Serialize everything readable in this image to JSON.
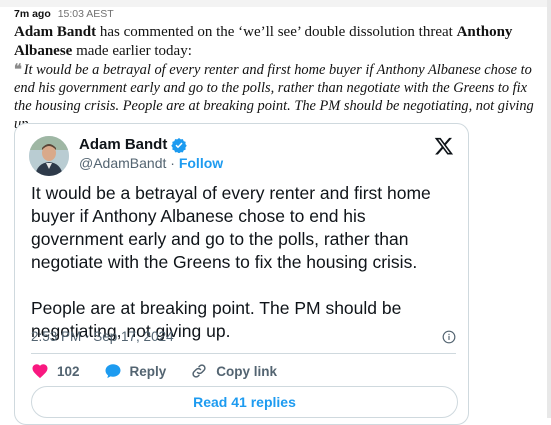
{
  "post": {
    "time_ago": "7m ago",
    "time": "15:03 AEST",
    "lead_name": "Adam Bandt",
    "lead_text": " has commented on the ‘we’ll see’ double dissolution threat ",
    "lead_name2": "Anthony Albanese",
    "lead_tail": " made earlier today:",
    "quote": "It would be a betrayal of every renter and first home buyer if Anthony Albanese chose to end his government early and go to the polls, rather than negotiate with the Greens to fix the housing crisis. People are at breaking point. The PM should be negotiating, not giving up."
  },
  "tweet": {
    "author": "Adam Bandt",
    "handle": "@AdamBandt",
    "separator": " · ",
    "follow_label": "Follow",
    "text": "It would be a betrayal of every renter and first home buyer if Anthony Albanese chose to end his government early and go to the polls, rather than negotiate with the Greens to fix the housing crisis.\n\nPeople are at breaking point. The PM should be negotiating, not giving up.",
    "timestamp": "2:53 PM · Sep 17, 2024",
    "likes": "102",
    "reply_label": "Reply",
    "copy_label": "Copy link",
    "replies_button": "Read 41 replies"
  },
  "colors": {
    "accent": "#1d9bf0",
    "like": "#f91880",
    "text": "#0f1419",
    "muted": "#536471"
  },
  "icons": [
    "quote-mark-icon",
    "verified-badge-icon",
    "x-logo-icon",
    "info-icon",
    "heart-icon",
    "reply-bubble-icon",
    "link-icon"
  ]
}
